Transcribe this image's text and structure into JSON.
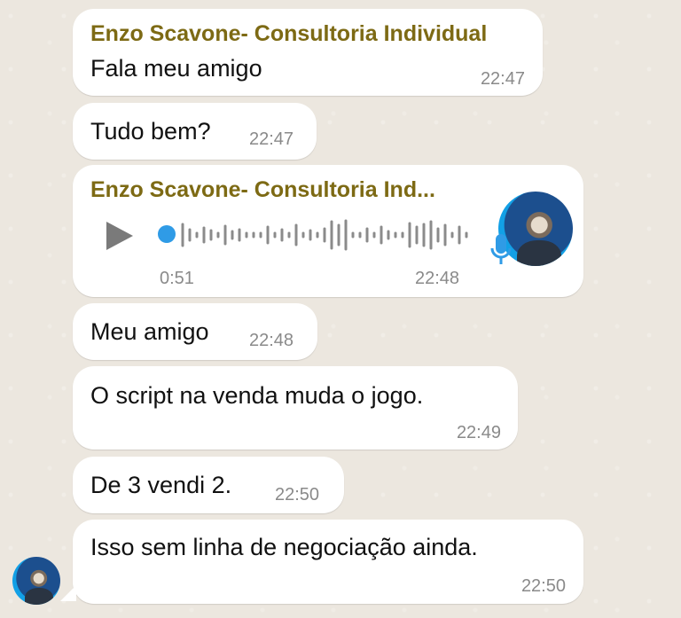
{
  "messages": [
    {
      "sender": "Enzo Scavone- Consultoria Individual",
      "text": "Fala meu amigo",
      "time": "22:47"
    },
    {
      "text": "Tudo bem?",
      "time": "22:47"
    },
    {
      "sender": "Enzo Scavone- Consultoria Ind...",
      "type": "audio",
      "duration": "0:51",
      "time": "22:48",
      "playback_progress": 0
    },
    {
      "text": "Meu amigo",
      "time": "22:48"
    },
    {
      "text": "O script na venda muda o jogo.",
      "time": "22:49"
    },
    {
      "text": "De 3 vendi 2.",
      "time": "22:50"
    },
    {
      "text": "Isso sem linha de negociação ainda.",
      "time": "22:50"
    }
  ],
  "colors": {
    "background": "#ece7df",
    "bubble": "#ffffff",
    "sender_name": "#7d6a14",
    "timestamp": "#8a8a8a",
    "audio_accent": "#2f9be6"
  },
  "icons": {
    "play": "play-icon",
    "mic": "microphone-icon",
    "avatar": "contact-avatar"
  }
}
